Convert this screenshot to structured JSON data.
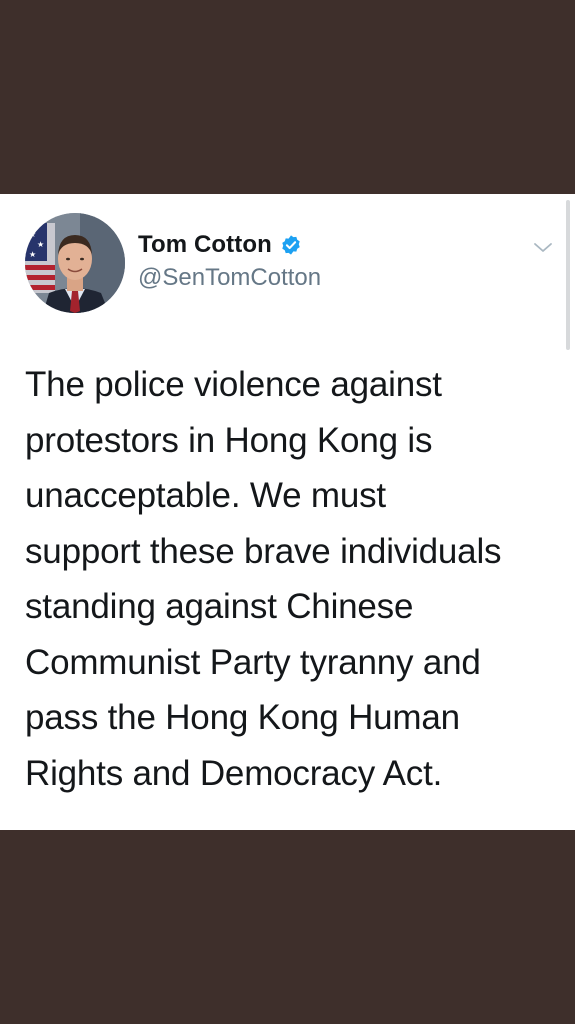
{
  "tweet": {
    "author": {
      "display_name": "Tom Cotton",
      "handle": "@SenTomCotton",
      "verified": true,
      "avatar": "avatar-photo"
    },
    "text": "The police violence against\nprotestors in Hong Kong is\nunacceptable. We must\nsupport these brave individuals\nstanding against Chinese\nCommunist Party tyranny and\npass the Hong Kong Human\nRights and Democracy Act.",
    "menu_icon": "chevron-down-icon"
  },
  "colors": {
    "background_band": "#3e2f2b",
    "card": "#ffffff",
    "name_text": "#14171a",
    "handle_text": "#657786",
    "verified_blue": "#1da1f2"
  }
}
